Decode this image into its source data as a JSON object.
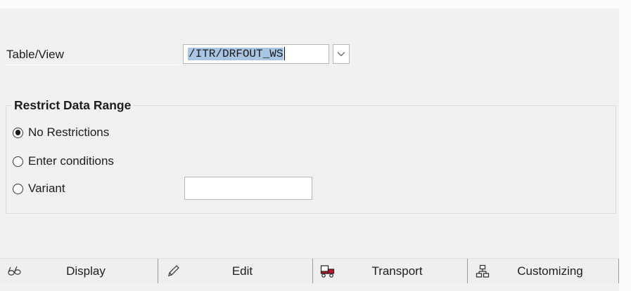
{
  "selection": {
    "table_view_label": "Table/View",
    "table_view_value": "/ITR/DRFOUT_WS"
  },
  "restrict": {
    "title": "Restrict Data Range",
    "options": [
      {
        "label": "No Restrictions",
        "selected": true
      },
      {
        "label": "Enter conditions",
        "selected": false
      },
      {
        "label": "Variant",
        "selected": false
      }
    ],
    "variant_value": ""
  },
  "toolbar": {
    "buttons": [
      {
        "label": "Display",
        "icon": "glasses-icon"
      },
      {
        "label": "Edit",
        "icon": "pencil-icon"
      },
      {
        "label": "Transport",
        "icon": "truck-icon"
      },
      {
        "label": "Customizing",
        "icon": "hierarchy-icon"
      }
    ]
  },
  "colors": {
    "background": "#f1f1f1",
    "selection_highlight": "#a9c5e4",
    "transport_icon": "#c8102e"
  }
}
